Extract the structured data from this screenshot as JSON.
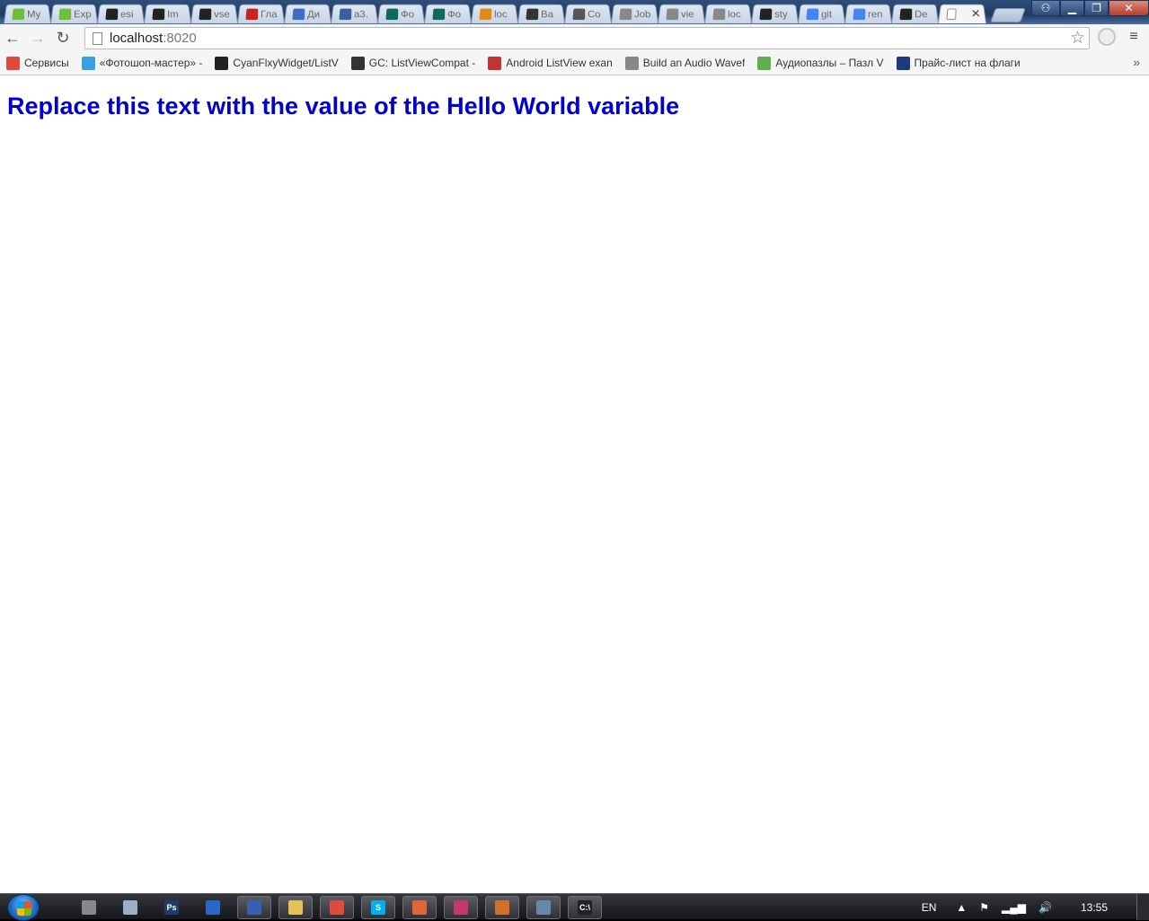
{
  "browser": {
    "tabs": [
      {
        "title": "My",
        "icon": "up-icon",
        "color": "#6fbf3a"
      },
      {
        "title": "Exp",
        "icon": "up-icon",
        "color": "#6fbf3a"
      },
      {
        "title": "esi",
        "icon": "github-icon",
        "color": "#222222"
      },
      {
        "title": "Im",
        "icon": "github-icon",
        "color": "#222222"
      },
      {
        "title": "vse",
        "icon": "github-icon",
        "color": "#222222"
      },
      {
        "title": "Гла",
        "icon": "anchor-icon",
        "color": "#cc2222"
      },
      {
        "title": "Ди",
        "icon": "chat-icon",
        "color": "#3a6fc4"
      },
      {
        "title": "a3.",
        "icon": "ship-icon",
        "color": "#3a5fa0"
      },
      {
        "title": "Фо",
        "icon": "g-icon",
        "color": "#0e6b5c"
      },
      {
        "title": "Фо",
        "icon": "g-icon",
        "color": "#0e6b5c"
      },
      {
        "title": "loc",
        "icon": "pma-icon",
        "color": "#e08a18"
      },
      {
        "title": "Ba",
        "icon": "bee-icon",
        "color": "#333333"
      },
      {
        "title": "Co",
        "icon": "bowl-icon",
        "color": "#555555"
      },
      {
        "title": "Job",
        "icon": "page-icon",
        "color": "#888888"
      },
      {
        "title": "vie",
        "icon": "page-icon",
        "color": "#888888"
      },
      {
        "title": "loc",
        "icon": "page-icon",
        "color": "#888888"
      },
      {
        "title": "sty",
        "icon": "github-icon",
        "color": "#222222"
      },
      {
        "title": "git",
        "icon": "google-icon",
        "color": "#4285f4"
      },
      {
        "title": "ren",
        "icon": "google-icon",
        "color": "#4285f4"
      },
      {
        "title": "De",
        "icon": "github-icon",
        "color": "#222222"
      }
    ],
    "active_tab": {
      "title": "",
      "icon": "page-icon",
      "close": "✕"
    },
    "window_controls": {
      "minimize": "▁",
      "maximize": "❐",
      "close": "✕"
    },
    "address": {
      "host": "localhost",
      "port": ":8020"
    },
    "bookmarks": [
      {
        "label": "Сервисы",
        "icon": "apps-grid-icon",
        "color": "#e04a3a"
      },
      {
        "label": "«Фотошоп-мастер» -",
        "icon": "fm-icon",
        "color": "#3aa0e0"
      },
      {
        "label": "CyanFlxyWidget/ListV",
        "icon": "github-icon",
        "color": "#222222"
      },
      {
        "label": "GC: ListViewCompat -",
        "icon": "gc-icon",
        "color": "#333333"
      },
      {
        "label": "Android ListView exan",
        "icon": "question-icon",
        "color": "#c33333"
      },
      {
        "label": "Build an Audio Wavef",
        "icon": "page-icon",
        "color": "#888888"
      },
      {
        "label": "Аудиопазлы – Пазл V",
        "icon": "puzzle-icon",
        "color": "#5fae4f"
      },
      {
        "label": "Прайс-лист на флаги",
        "icon": "p-icon",
        "color": "#1f3a7a"
      }
    ],
    "bookmarks_more": "»"
  },
  "page": {
    "heading": "Replace this text with the value of the Hello World variable",
    "heading_color": "#0000cd"
  },
  "taskbar": {
    "apps": [
      {
        "name": "app-icon-1",
        "glyph": "",
        "color": "#888888",
        "button": false
      },
      {
        "name": "calculator-icon",
        "glyph": "",
        "color": "#9ab0c8",
        "button": false
      },
      {
        "name": "photoshop-icon",
        "glyph": "Ps",
        "color": "#1b3e6e",
        "button": false
      },
      {
        "name": "app-icon-blue",
        "glyph": "",
        "color": "#2a66c4",
        "button": false
      },
      {
        "name": "floppy-icon",
        "glyph": "",
        "color": "#3a5fb0",
        "button": true
      },
      {
        "name": "explorer-icon",
        "glyph": "",
        "color": "#e6c15a",
        "button": true
      },
      {
        "name": "chrome-icon",
        "glyph": "",
        "color": "#e04a3a",
        "button": true
      },
      {
        "name": "skype-icon",
        "glyph": "S",
        "color": "#00aff0",
        "button": true
      },
      {
        "name": "xampp-icon",
        "glyph": "",
        "color": "#e0663a",
        "button": true
      },
      {
        "name": "app-icon-striped",
        "glyph": "",
        "color": "#c23a6a",
        "button": true
      },
      {
        "name": "sublime-icon",
        "glyph": "",
        "color": "#d0702a",
        "button": true
      },
      {
        "name": "app-icon-turtle",
        "glyph": "",
        "color": "#6688aa",
        "button": true
      },
      {
        "name": "cmd-icon",
        "glyph": "C:\\",
        "color": "#222222",
        "button": true
      }
    ],
    "tray": {
      "lang": "EN",
      "clock": "13:55"
    }
  }
}
